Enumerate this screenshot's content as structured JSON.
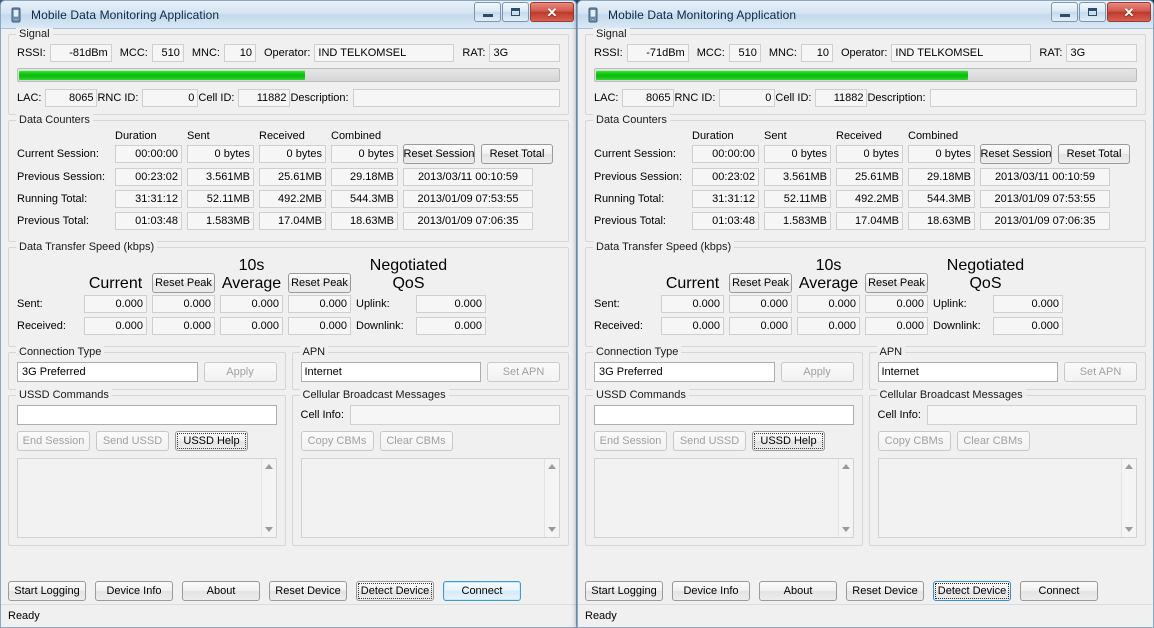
{
  "window_title": "Mobile Data Monitoring Application",
  "titlebar": {
    "icon": "mobile-device-icon",
    "minimize": "minimize-icon",
    "maximize": "maximize-icon",
    "close": "close-icon",
    "close_glyph": "✕"
  },
  "groups": {
    "signal": "Signal",
    "data_counters": "Data Counters",
    "speed": "Data Transfer Speed (kbps)",
    "connection_type": "Connection Type",
    "apn": "APN",
    "ussd": "USSD Commands",
    "cbm": "Cellular Broadcast Messages"
  },
  "labels": {
    "rssi": "RSSI:",
    "mcc": "MCC:",
    "mnc": "MNC:",
    "operator": "Operator:",
    "rat": "RAT:",
    "lac": "LAC:",
    "rnc_id": "RNC ID:",
    "cell_id": "Cell ID:",
    "description": "Description:",
    "duration": "Duration",
    "sent": "Sent",
    "received": "Received",
    "combined": "Combined",
    "current": "Current",
    "tenS_average": "10s Average",
    "negotiated_qos": "Negotiated QoS",
    "sent_colon": "Sent:",
    "received_colon": "Received:",
    "uplink": "Uplink:",
    "downlink": "Downlink:",
    "cell_info": "Cell Info:"
  },
  "buttons": {
    "reset_session": "Reset Session",
    "reset_total": "Reset Total",
    "reset_peak": "Reset Peak",
    "apply": "Apply",
    "set_apn": "Set APN",
    "end_session": "End Session",
    "send_ussd": "Send USSD",
    "ussd_help": "USSD Help",
    "copy_cbms": "Copy CBMs",
    "clear_cbms": "Clear CBMs",
    "start_logging": "Start Logging",
    "device_info": "Device Info",
    "about": "About",
    "reset_device": "Reset Device",
    "detect_device": "Detect Device",
    "connect": "Connect"
  },
  "counter_rows": [
    {
      "label": "Current Session:",
      "duration": "00:00:00",
      "sent": "0 bytes",
      "received": "0 bytes",
      "combined": "0 bytes",
      "timestamp": ""
    },
    {
      "label": "Previous Session:",
      "duration": "00:23:02",
      "sent": "3.561MB",
      "received": "25.61MB",
      "combined": "29.18MB",
      "timestamp": "2013/03/11 00:10:59"
    },
    {
      "label": "Running Total:",
      "duration": "31:31:12",
      "sent": "52.11MB",
      "received": "492.2MB",
      "combined": "544.3MB",
      "timestamp": "2013/01/09 07:53:55"
    },
    {
      "label": "Previous Total:",
      "duration": "01:03:48",
      "sent": "1.583MB",
      "received": "17.04MB",
      "combined": "18.63MB",
      "timestamp": "2013/01/09 07:06:35"
    }
  ],
  "speed_rows": [
    {
      "label": "Sent:",
      "current": "0.000",
      "current_peak": "0.000",
      "avg": "0.000",
      "avg_peak": "0.000",
      "qos_label": "Uplink:",
      "qos": "0.000"
    },
    {
      "label": "Received:",
      "current": "0.000",
      "current_peak": "0.000",
      "avg": "0.000",
      "avg_peak": "0.000",
      "qos_label": "Downlink:",
      "qos": "0.000"
    }
  ],
  "status_text": "Ready",
  "colors": {
    "signal_green": "#13c913",
    "default_button_blue": "#3c9bd4",
    "title_close_red": "#bb3a2d"
  },
  "windows": [
    {
      "id": "left",
      "signal": {
        "rssi": "-81dBm",
        "mcc": "510",
        "mnc": "10",
        "operator": "IND TELKOMSEL",
        "rat": "3G",
        "lac": "8065",
        "rnc_id": "0",
        "cell_id": "11882",
        "description": "",
        "bar_percent": "53"
      },
      "connection_type_value": "3G Preferred",
      "apn_value": "Internet",
      "ussd_input": "",
      "cell_info": "",
      "focused_button": "connect"
    },
    {
      "id": "right",
      "signal": {
        "rssi": "-71dBm",
        "mcc": "510",
        "mnc": "10",
        "operator": "IND TELKOMSEL",
        "rat": "3G",
        "lac": "8065",
        "rnc_id": "0",
        "cell_id": "11882",
        "description": "",
        "bar_percent": "69"
      },
      "connection_type_value": "3G Preferred",
      "apn_value": "Internet",
      "ussd_input": "",
      "cell_info": "",
      "focused_button": "detect_device"
    }
  ]
}
